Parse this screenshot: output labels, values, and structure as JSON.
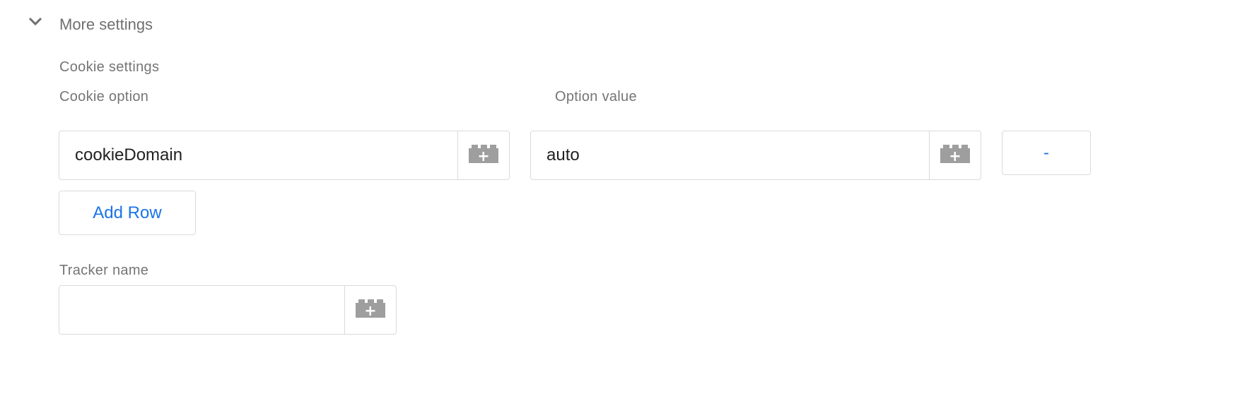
{
  "section": {
    "title": "More settings"
  },
  "cookie_settings": {
    "heading": "Cookie settings",
    "col_option": "Cookie option",
    "col_value": "Option value",
    "rows": [
      {
        "option": "cookieDomain",
        "value": "auto",
        "remove_label": "-"
      }
    ],
    "add_row_label": "Add Row"
  },
  "tracker": {
    "label": "Tracker name",
    "value": ""
  },
  "colors": {
    "accent": "#1a73e8",
    "icon": "#9e9e9e",
    "border": "#dadada"
  }
}
